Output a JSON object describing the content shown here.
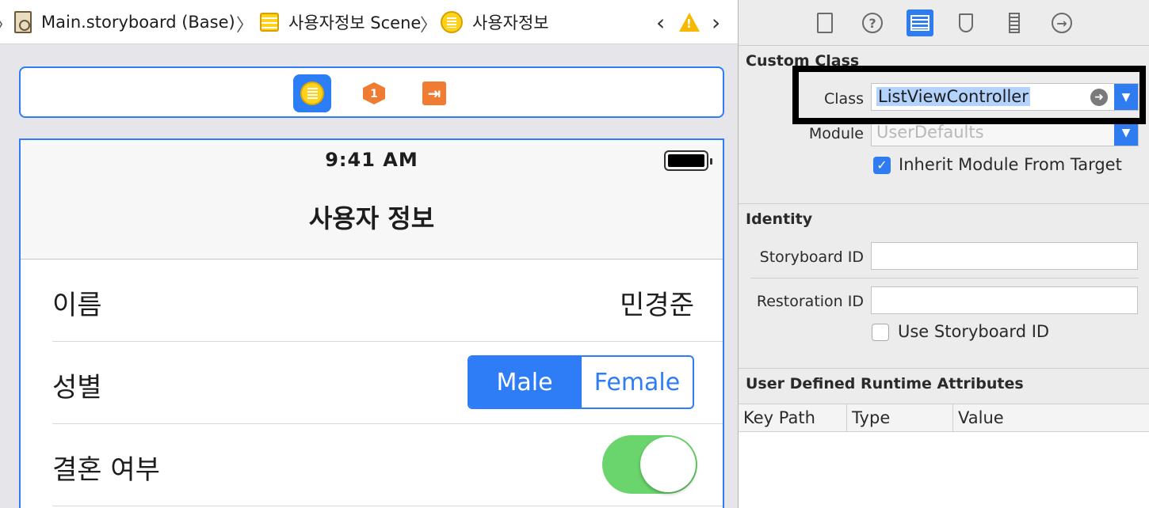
{
  "jumpbar": {
    "storyboard": "Main.storyboard (Base)",
    "scene": "사용자정보 Scene",
    "controller": "사용자정보"
  },
  "canvas": {
    "scene_dock": {
      "icons": [
        "view-controller-icon",
        "first-responder-icon",
        "exit-icon"
      ],
      "first_responder_badge": "1"
    },
    "phone": {
      "status_time": "9:41 AM",
      "nav_title": "사용자 정보",
      "rows": [
        {
          "label": "이름",
          "value": "민경준"
        },
        {
          "label": "성별",
          "segments": [
            "Male",
            "Female"
          ],
          "selected_index": 0
        },
        {
          "label": "결혼 여부",
          "switch_on": true
        }
      ]
    }
  },
  "inspector": {
    "custom_class": {
      "title": "Custom Class",
      "class_label": "Class",
      "class_value": "ListViewController",
      "module_label": "Module",
      "module_placeholder": "UserDefaults",
      "inherit_label": "Inherit Module From Target",
      "inherit_checked": true
    },
    "identity": {
      "title": "Identity",
      "storyboard_id_label": "Storyboard ID",
      "storyboard_id_value": "",
      "restoration_id_label": "Restoration ID",
      "restoration_id_value": "",
      "use_storyboard_id_label": "Use Storyboard ID",
      "use_storyboard_id_checked": false
    },
    "runtime_attributes": {
      "title": "User Defined Runtime Attributes",
      "columns": [
        "Key Path",
        "Type",
        "Value"
      ]
    }
  },
  "colors": {
    "accent": "#2e7df6",
    "switch_green": "#6ad56c",
    "warning": "#f6b800",
    "highlight_border": "#000000"
  }
}
